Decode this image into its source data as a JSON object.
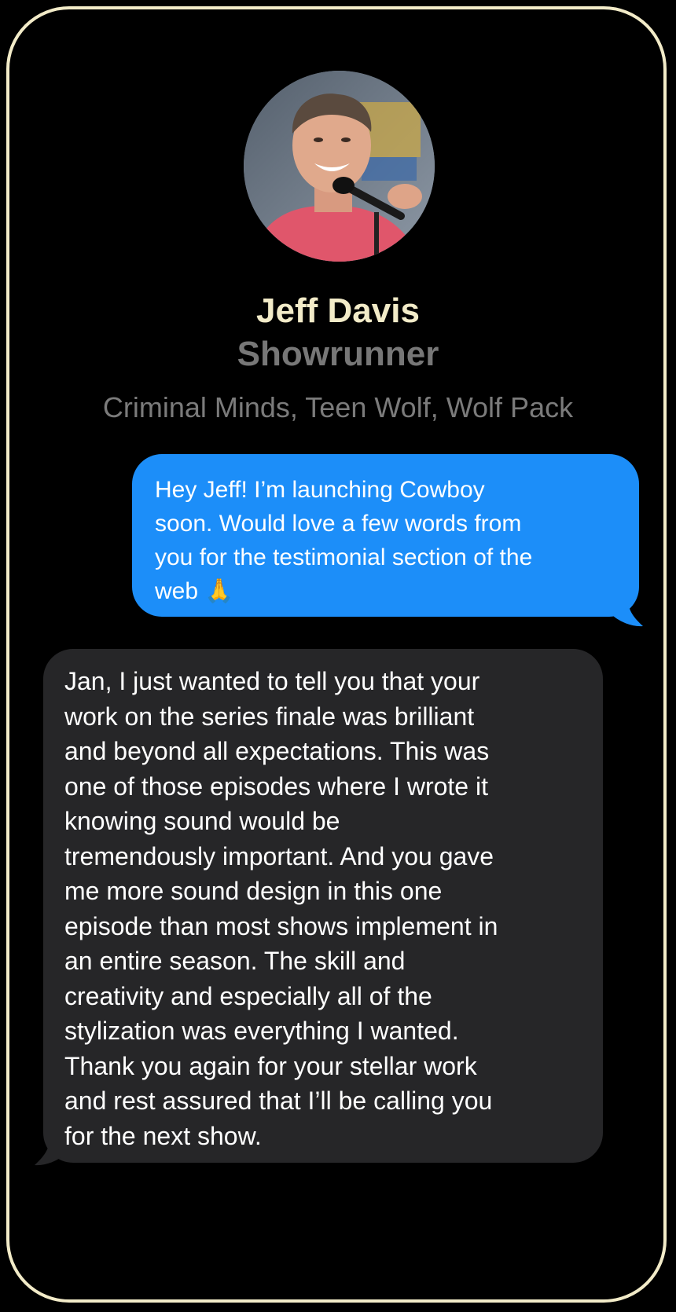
{
  "contact": {
    "name": "Jeff Davis",
    "role": "Showrunner",
    "credits": "Criminal Minds, Teen Wolf, Wolf Pack",
    "avatar_icon": "person-photo"
  },
  "messages": [
    {
      "direction": "outgoing",
      "text": "Hey Jeff! I’m launching Cowboy\nsoon. Would love a few words from\nyou for the testimonial section of the\nweb 🙏"
    },
    {
      "direction": "incoming",
      "text": "Jan, I just wanted to tell you that your\nwork on the series finale was brilliant\nand beyond all expectations. This was\none of those episodes where I wrote it\nknowing sound would be\ntremendously important. And you gave\nme more sound design in this one\nepisode than most shows implement in\nan entire season. The skill and\ncreativity and especially all of the\nstylization was everything I wanted.\nThank you again for your stellar work\nand rest assured that I’ll be calling you\nfor the next show."
    }
  ],
  "colors": {
    "frame_border": "#f2ebc8",
    "name": "#f2ebc8",
    "subtitle": "#777777",
    "sent_bubble": "#1c8ef9",
    "received_bubble": "#262628"
  }
}
